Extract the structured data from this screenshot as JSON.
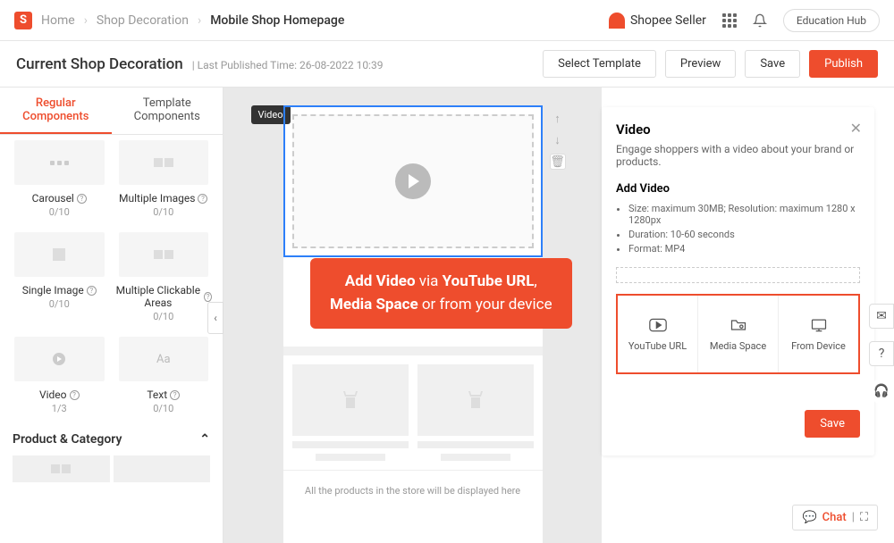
{
  "breadcrumbs": {
    "home": "Home",
    "shop": "Shop Decoration",
    "current": "Mobile Shop Homepage"
  },
  "brand": "Shopee Seller",
  "edu": "Education Hub",
  "subbar": {
    "title": "Current Shop Decoration",
    "meta": "Last Published Time: 26-08-2022 10:39",
    "select": "Select Template",
    "preview": "Preview",
    "save": "Save",
    "publish": "Publish"
  },
  "tabs": {
    "regular": "Regular Components",
    "template": "Template Components"
  },
  "components": {
    "carousel": {
      "label": "Carousel",
      "count": "0/10"
    },
    "multiImg": {
      "label": "Multiple Images",
      "count": "0/10"
    },
    "single": {
      "label": "Single Image",
      "count": "0/10"
    },
    "clickable": {
      "label": "Multiple Clickable Areas",
      "count": "0/10"
    },
    "video": {
      "label": "Video",
      "count": "1/3"
    },
    "text": {
      "label": "Text",
      "count": "0/10"
    }
  },
  "section": "Product & Category",
  "tag": "Video",
  "productsNote": "All the products in the store will be displayed here",
  "panel": {
    "title": "Video",
    "desc": "Engage shoppers with a video about your brand or products.",
    "addTitle": "Add Video",
    "spec1": "Size: maximum 30MB; Resolution: maximum 1280 x 1280px",
    "spec2": "Duration: 10-60 seconds",
    "spec3": "Format: MP4",
    "opt1": "YouTube URL",
    "opt2": "Media Space",
    "opt3": "From Device",
    "save": "Save"
  },
  "callout": {
    "l1a": "Add Video",
    "l1b": " via ",
    "l1c": "YouTube URL",
    "l2a": "Media Space",
    "l2b": " or from your device"
  },
  "chat": "Chat"
}
